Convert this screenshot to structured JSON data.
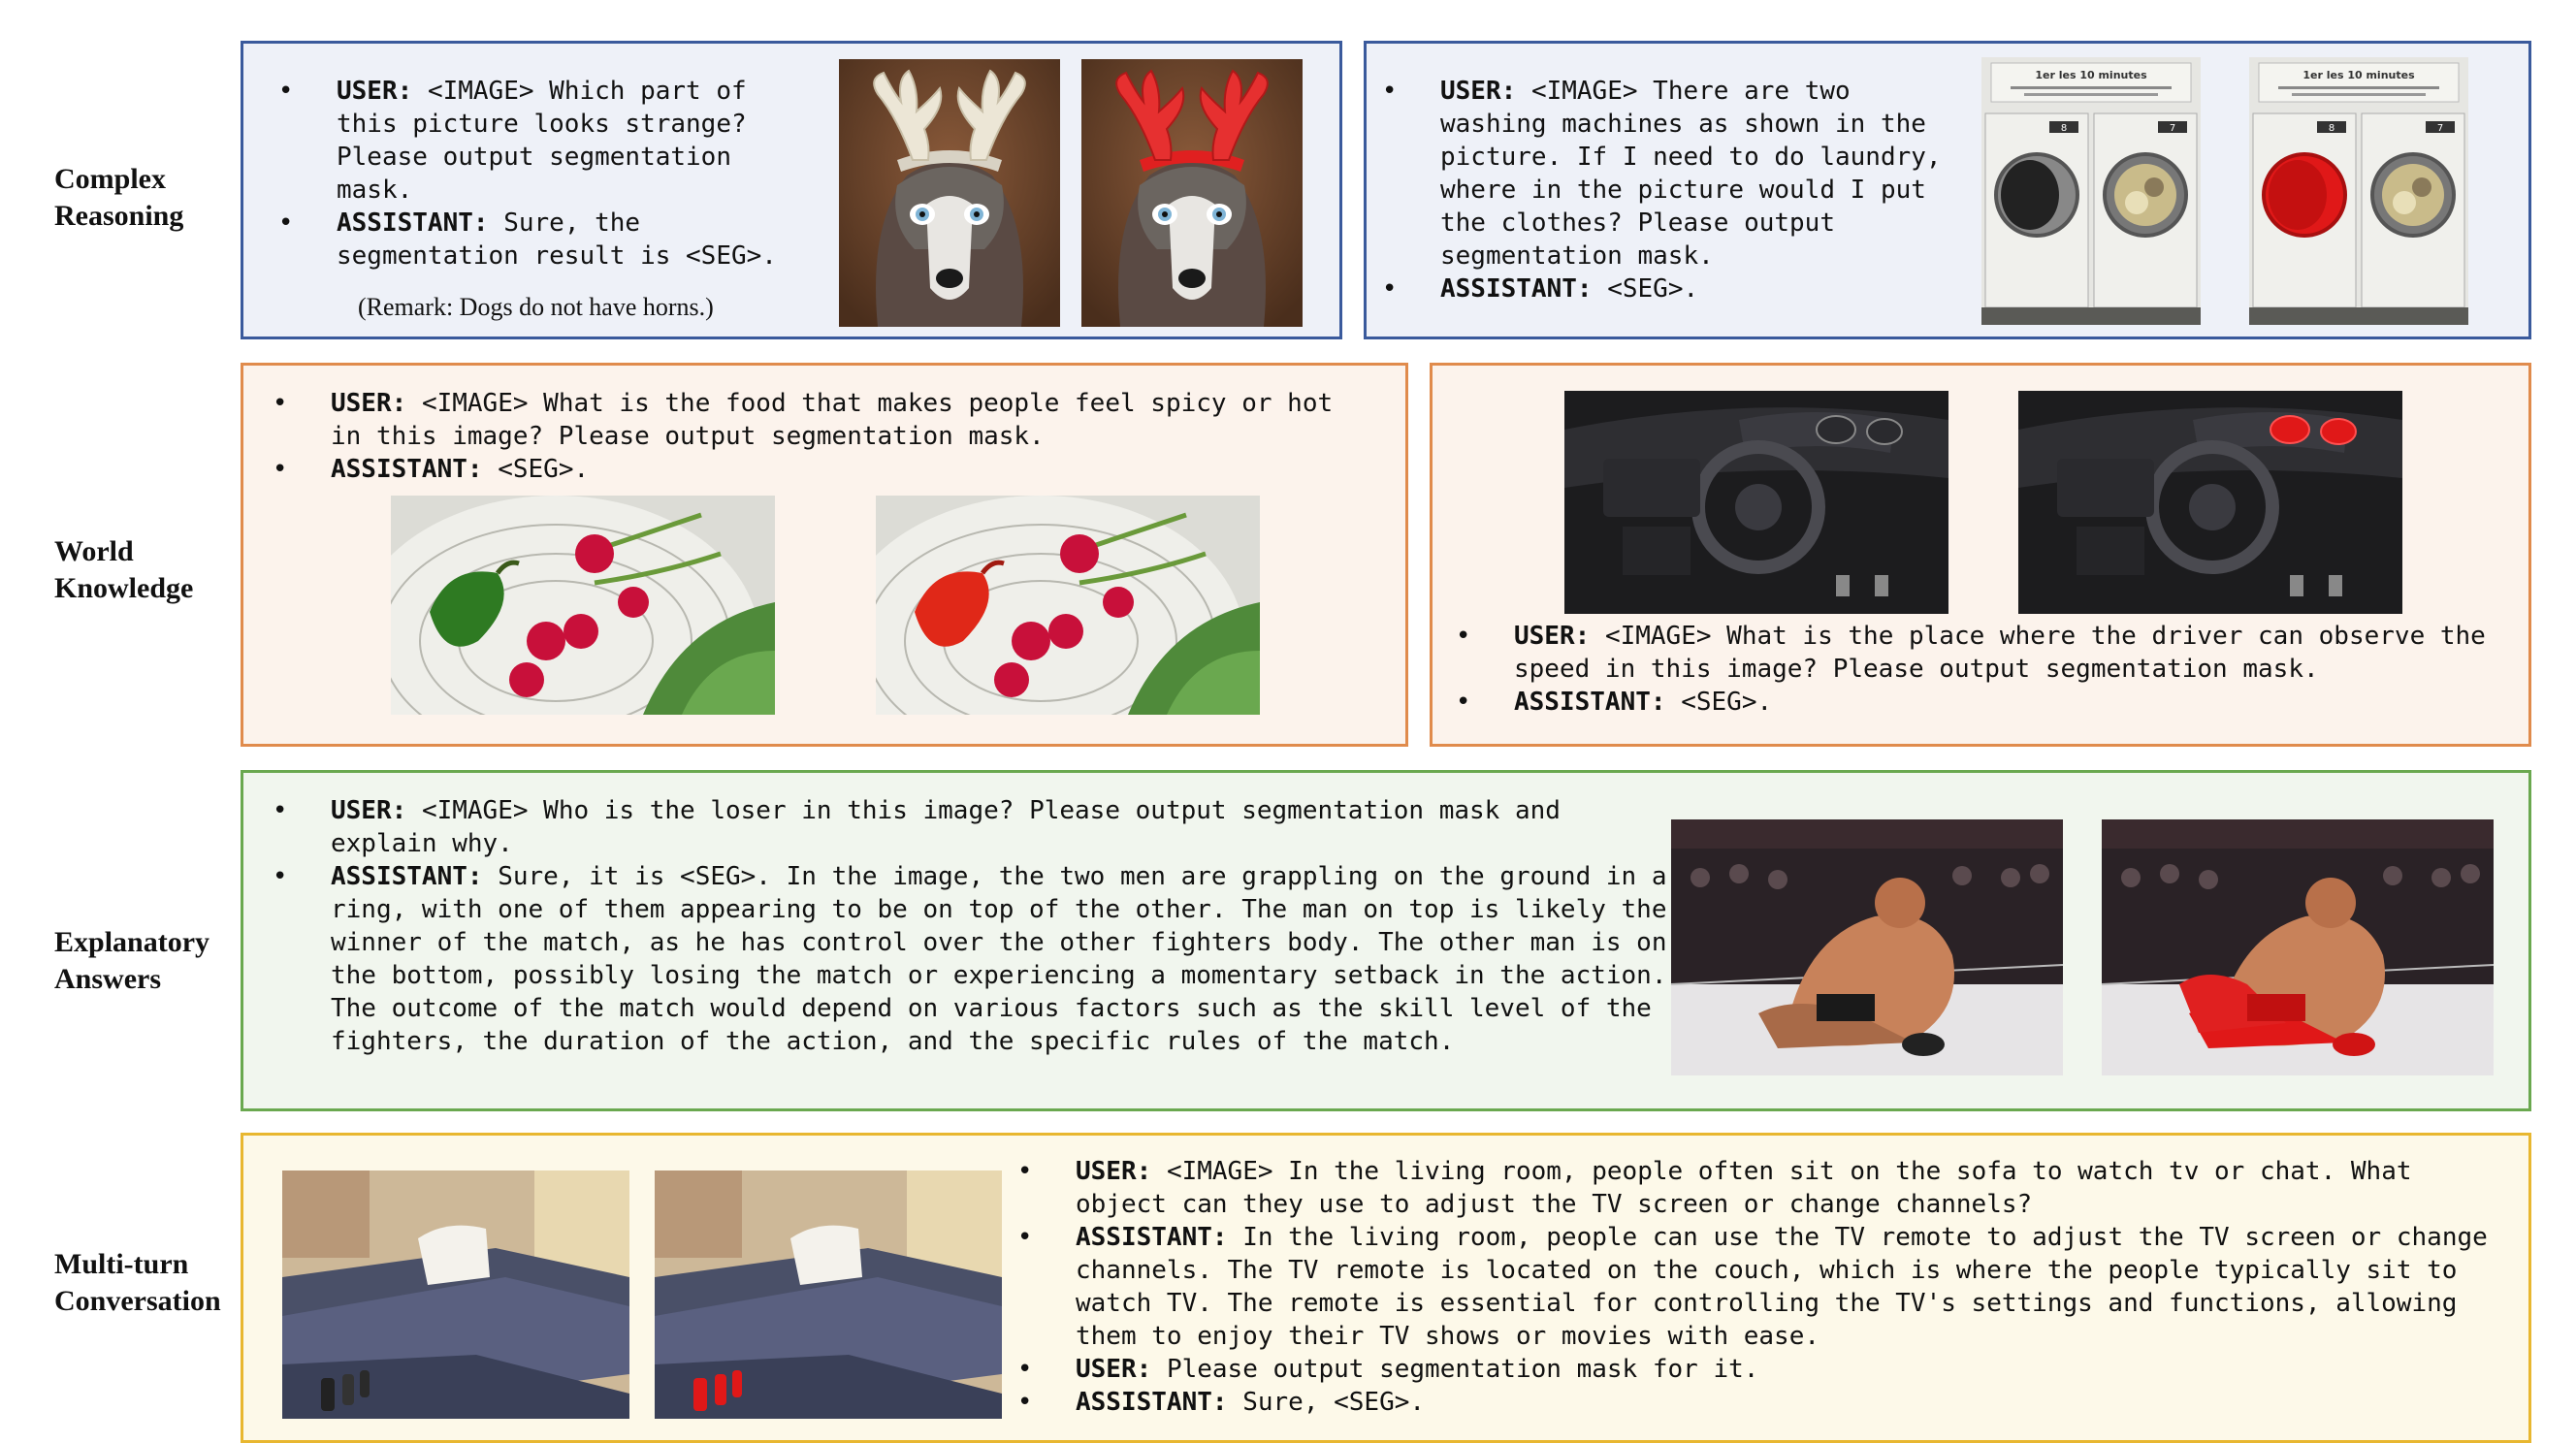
{
  "rows": [
    {
      "label_line1": "Complex",
      "label_line2": "Reasoning",
      "left_panel": {
        "user_role": "USER:",
        "user_text": "<IMAGE> Which part of this picture looks strange? Please output segmentation mask.",
        "assistant_role": "ASSISTANT:",
        "assistant_text": "Sure, the segmentation result is <SEG>.",
        "remark": "(Remark: Dogs do not have horns.)"
      },
      "right_panel": {
        "user_role": "USER:",
        "user_text": "<IMAGE> There are two washing machines as shown in the picture. If I need to do laundry, where in the picture would I put the clothes? Please output segmentation mask.",
        "assistant_role": "ASSISTANT:",
        "assistant_text": "<SEG>.",
        "sign_text": "1er les 10 minutes",
        "digit_left": "8",
        "digit_right": "7"
      }
    },
    {
      "label_line1": "World",
      "label_line2": "Knowledge",
      "left_panel": {
        "user_role": "USER:",
        "user_text": "<IMAGE> What is the food that makes people feel spicy or hot in this image? Please output segmentation mask.",
        "assistant_role": "ASSISTANT:",
        "assistant_text": "<SEG>."
      },
      "right_panel": {
        "user_role": "USER:",
        "user_text": "<IMAGE> What is the place where the driver can observe the speed in this image? Please output segmentation mask.",
        "assistant_role": "ASSISTANT:",
        "assistant_text": "<SEG>."
      }
    },
    {
      "label_line1": "Explanatory",
      "label_line2": "Answers",
      "panel": {
        "user_role": "USER:",
        "user_text": "<IMAGE> Who is the loser in this image? Please output segmentation mask and explain why.",
        "assistant_role": "ASSISTANT:",
        "assistant_text": "Sure, it is <SEG>. In the image, the two men are grappling on the ground in a ring, with one of them appearing to be on top of the other. The man on top is likely the winner of the match, as he has control over the other fighters body. The other man is on the bottom, possibly losing the match or experiencing a momentary setback in the action. The outcome of the match would depend on various factors such as the skill level of the fighters, the duration of the action, and the specific rules of the match."
      }
    },
    {
      "label_line1": "Multi-turn",
      "label_line2": "Conversation",
      "panel": {
        "turns": [
          {
            "role": "USER:",
            "text": "<IMAGE> In the living room, people often sit on the sofa to watch tv or chat. What object can they use to adjust the TV screen or change channels?"
          },
          {
            "role": "ASSISTANT:",
            "text": "In the living room, people can use the TV remote to adjust the TV screen or change channels. The TV remote is located on the couch, which is where the people typically sit to watch TV. The remote is essential for controlling the TV's settings and functions, allowing them to enjoy their TV shows or movies with ease."
          },
          {
            "role": "USER:",
            "text": "Please output segmentation mask for it."
          },
          {
            "role": "ASSISTANT:",
            "text": "Sure, <SEG>."
          }
        ]
      }
    }
  ],
  "colors": {
    "complex_border": "#3a5a9c",
    "world_border": "#e08b4c",
    "explanatory_border": "#6aa84f",
    "multiturn_border": "#e8b730",
    "mask": "#e01818"
  }
}
